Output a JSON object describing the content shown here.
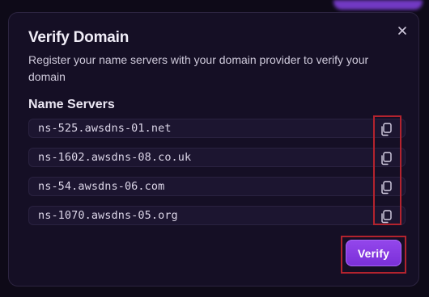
{
  "dialog": {
    "title": "Verify Domain",
    "description": "Register your name servers with your domain provider to verify your domain",
    "close_icon": "close-icon"
  },
  "name_servers": {
    "heading": "Name Servers",
    "items": [
      {
        "value": "ns-525.awsdns-01.net",
        "copy_icon": "copy-icon"
      },
      {
        "value": "ns-1602.awsdns-08.co.uk",
        "copy_icon": "copy-icon"
      },
      {
        "value": "ns-54.awsdns-06.com",
        "copy_icon": "copy-icon"
      },
      {
        "value": "ns-1070.awsdns-05.org",
        "copy_icon": "copy-icon"
      }
    ]
  },
  "actions": {
    "verify_label": "Verify"
  },
  "colors": {
    "accent": "#8b3fe6",
    "highlight": "#b3232e",
    "modal_bg": "#150f25"
  }
}
